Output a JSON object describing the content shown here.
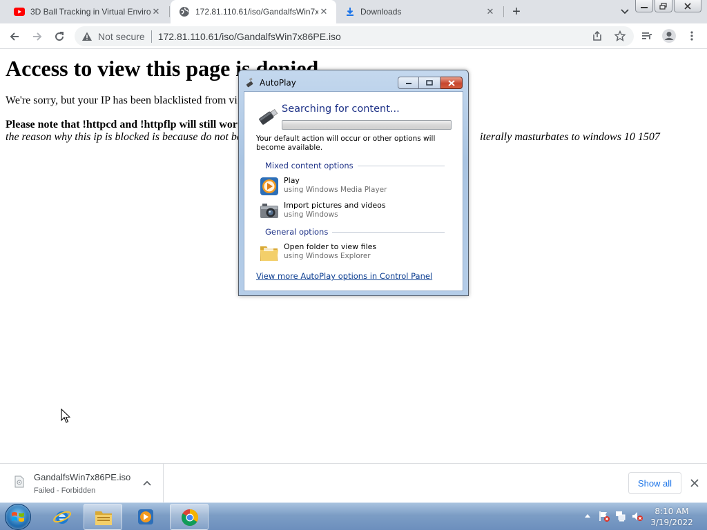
{
  "browser": {
    "tabs": [
      {
        "title": "3D Ball Tracking in Virtual Enviro",
        "icon": "youtube-icon",
        "active": false
      },
      {
        "title": "172.81.110.61/iso/GandalfsWin7x",
        "icon": "globe-icon",
        "active": true
      },
      {
        "title": "Downloads",
        "icon": "download-icon",
        "active": false
      }
    ],
    "new_tab_symbol": "+",
    "security_label": "Not secure",
    "url": "172.81.110.61/iso/GandalfsWin7x86PE.iso"
  },
  "page": {
    "heading": "Access to view this page is denied",
    "paragraph1": "We're sorry, but your IP has been blacklisted from vi",
    "paragraph2": "Please note that !httpcd and !httpflp will still wor",
    "paragraph3_start": "the reason why this ip is blocked is because do not be",
    "paragraph3_end": "iterally masturbates to windows 10 1507"
  },
  "autoplay": {
    "title": "AutoPlay",
    "searching": "Searching for content...",
    "default_text": "Your default action will occur or other options will become available.",
    "mixed_header": "Mixed content options",
    "general_header": "General options",
    "options": [
      {
        "label": "Play",
        "sub": "using Windows Media Player",
        "icon": "media-player-icon"
      },
      {
        "label": "Import pictures and videos",
        "sub": "using Windows",
        "icon": "camera-icon"
      },
      {
        "label": "Open folder to view files",
        "sub": "using Windows Explorer",
        "icon": "folder-icon"
      }
    ],
    "control_panel_link": "View more AutoPlay options in Control Panel"
  },
  "downloads": {
    "filename": "GandalfsWin7x86PE.iso",
    "status": "Failed - Forbidden",
    "show_all": "Show all"
  },
  "taskbar": {
    "time": "8:10 AM",
    "date": "3/19/2022"
  },
  "colors": {
    "link": "#1a73e8",
    "dialog_accent": "#1e3287"
  }
}
